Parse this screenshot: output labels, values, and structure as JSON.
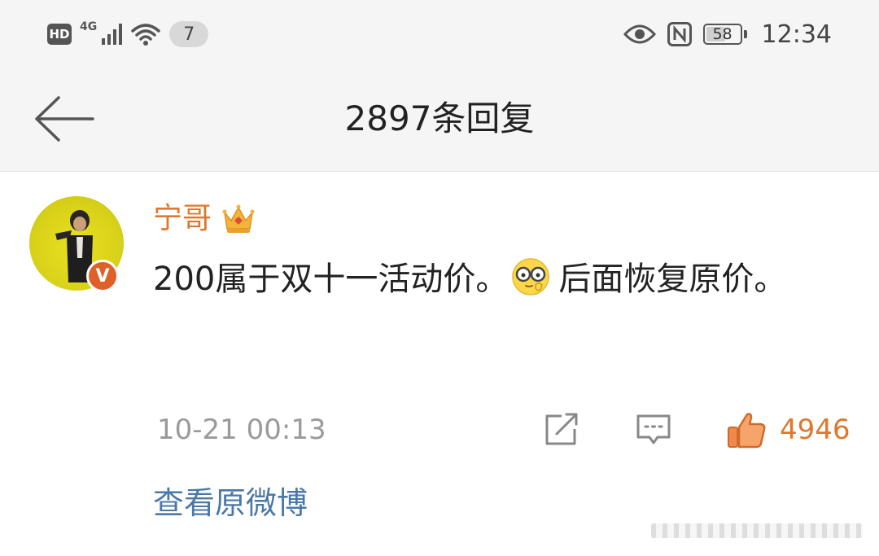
{
  "status_bar": {
    "hd_label": "HD",
    "network_label": "4G",
    "notification_count": "7",
    "battery_level": "58",
    "battery_fraction": 0.58,
    "time": "12:34",
    "icons": [
      "hd-icon",
      "signal-icon",
      "wifi-icon",
      "eye-icon",
      "nfc-icon",
      "battery-icon"
    ]
  },
  "header": {
    "title": "2897条回复",
    "back_icon": "arrow-left-icon"
  },
  "comment": {
    "username": "宁哥",
    "username_color": "#e0772c",
    "verified_label": "V",
    "text_part1": "200属于双十一活动价。",
    "text_part2": "后面恢复原价。",
    "emoji": "glasses-emoji-icon",
    "timestamp": "10-21 00:13",
    "like_count": "4946",
    "view_original_label": "查看原微博",
    "link_color": "#4a78a8"
  }
}
